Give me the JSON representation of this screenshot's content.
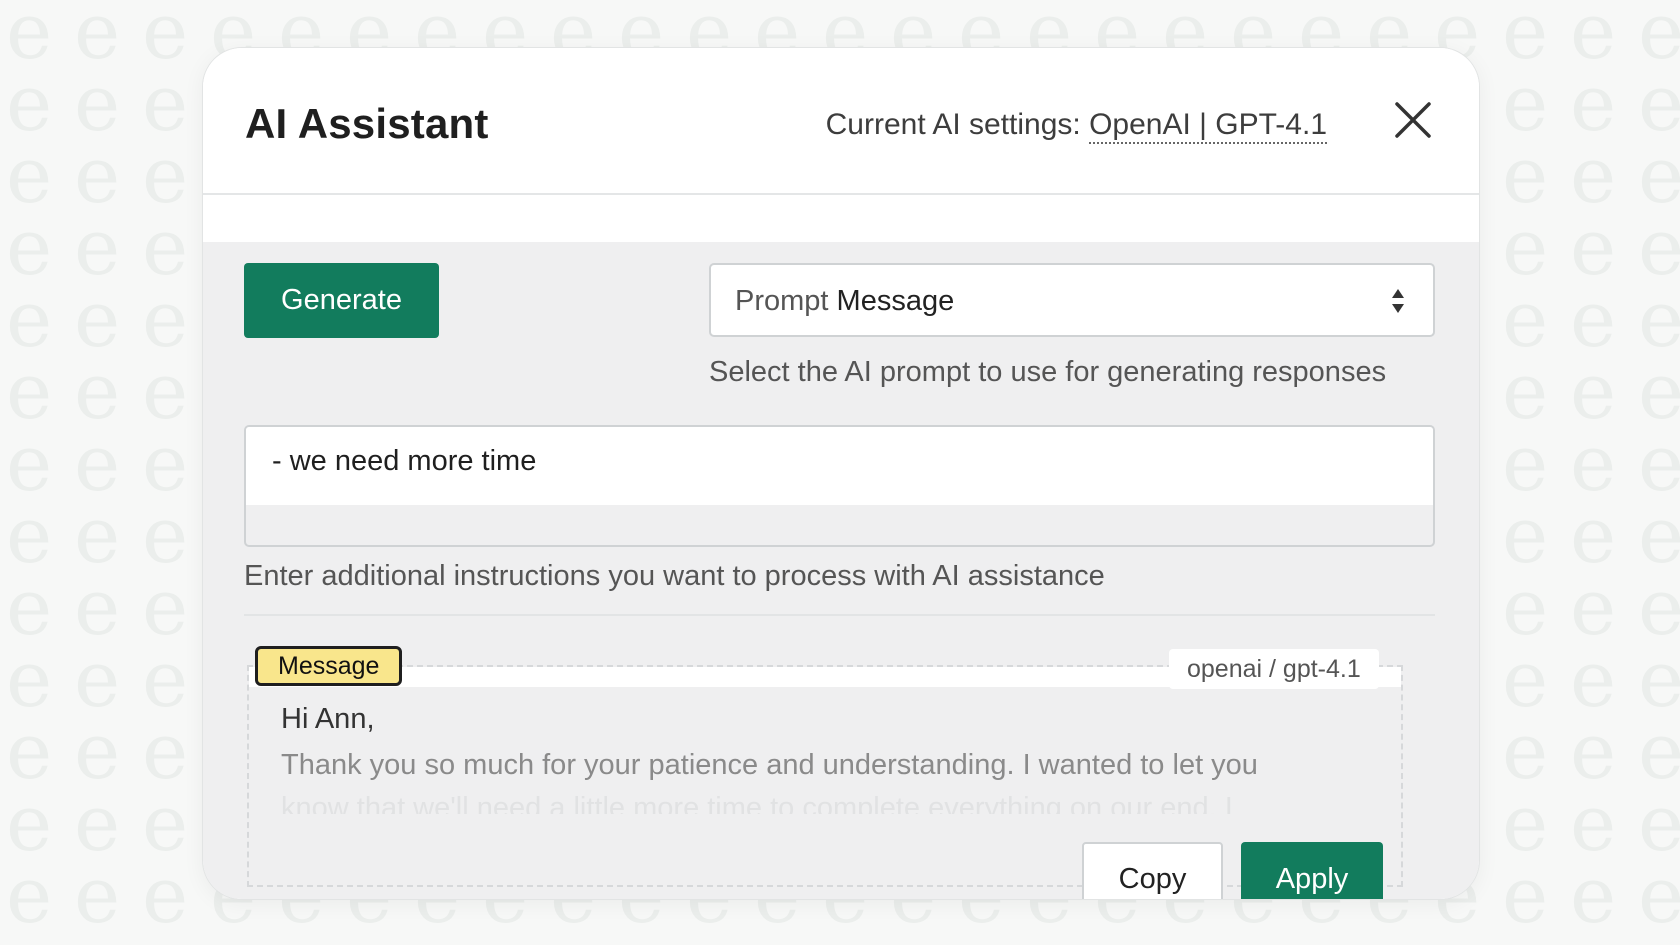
{
  "header": {
    "title": "AI Assistant",
    "settings_prefix": "Current AI settings: ",
    "settings_value": "OpenAI | GPT-4.1",
    "close_icon": "close-icon"
  },
  "toolbar": {
    "generate_label": "Generate"
  },
  "prompt_select": {
    "prefix": "Prompt ",
    "value": "Message",
    "help": "Select the AI prompt to use for generating responses",
    "icon": "select-arrows-icon"
  },
  "instructions": {
    "value": "- we need more time",
    "help": "Enter additional instructions you want to process with AI assistance"
  },
  "result": {
    "badge": "Message",
    "model": "openai / gpt-4.1",
    "greeting": "Hi Ann,",
    "line1": "Thank you so much for your patience and understanding. I wanted to let you",
    "line2": "know that we'll need a little more time to complete everything on our end. I",
    "copy_label": "Copy",
    "apply_label": "Apply"
  },
  "colors": {
    "primary": "#127c5d",
    "badge_bg": "#f9e68c",
    "panel_bg": "#efeff0",
    "background": "#f7f8f7"
  }
}
